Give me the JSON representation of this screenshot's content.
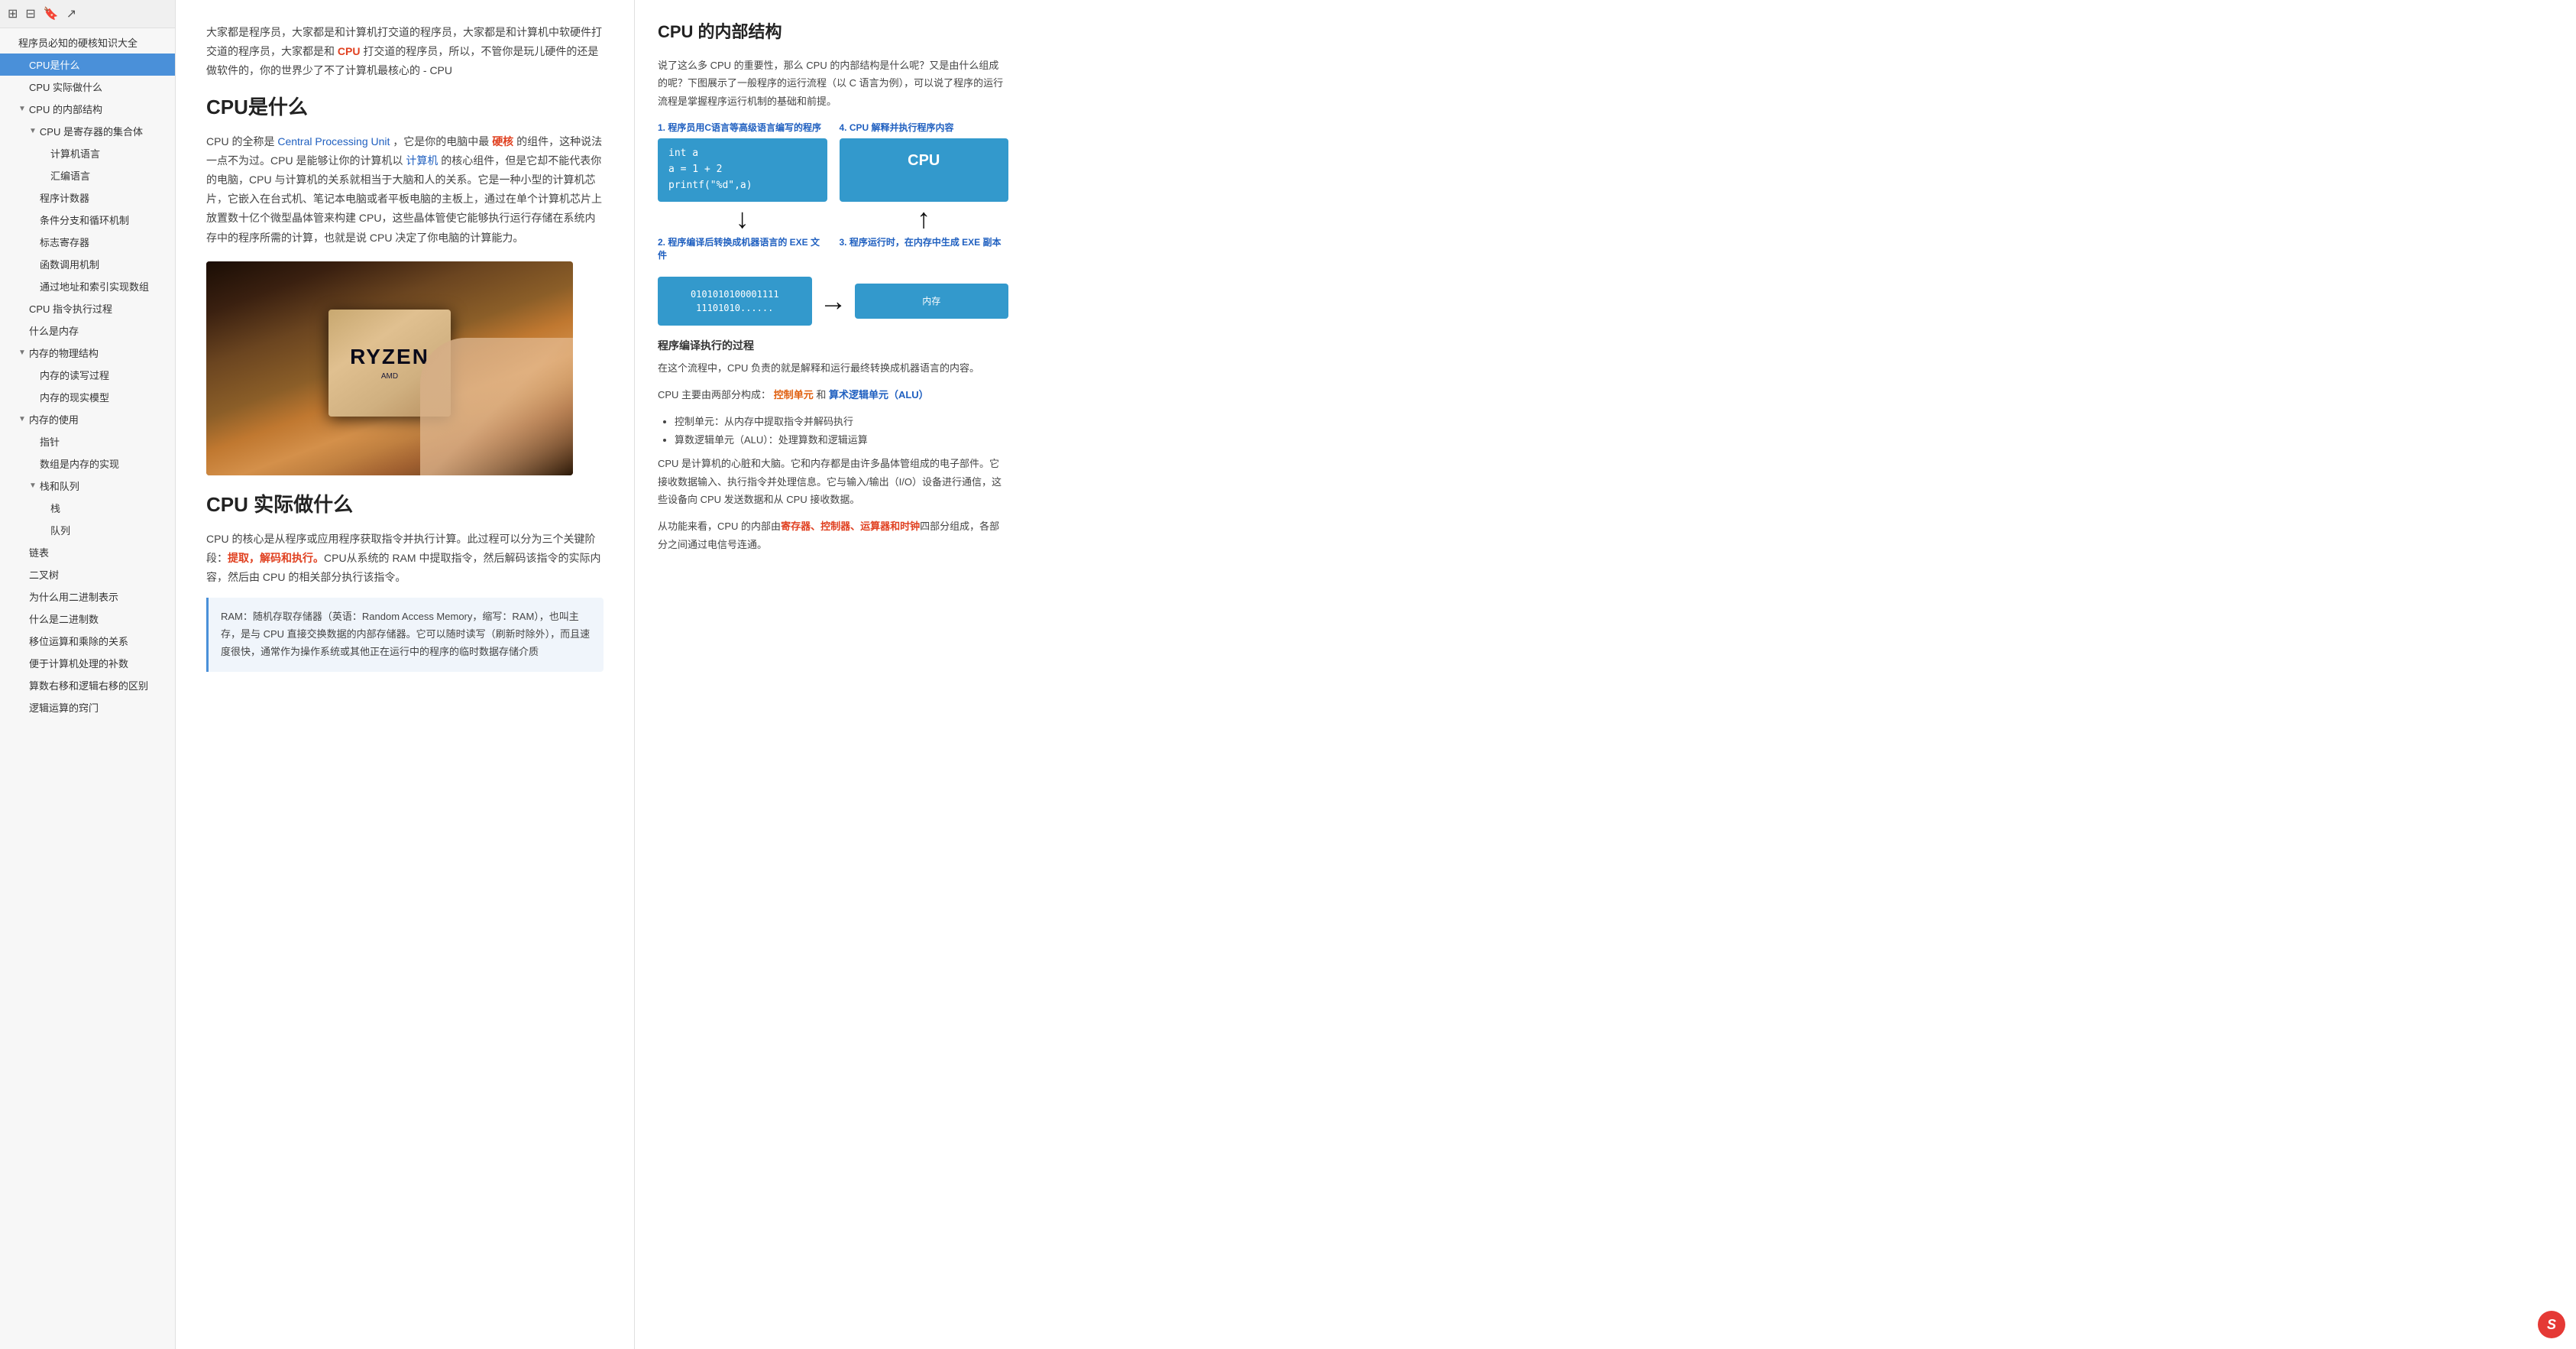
{
  "sidebar": {
    "toolbar_icons": [
      "grid-icon",
      "grid2-icon",
      "bookmark-icon",
      "share-icon"
    ],
    "items": [
      {
        "label": "程序员必知的硬核知识大全",
        "level": 0,
        "toggle": null,
        "active": false
      },
      {
        "label": "CPU是什么",
        "level": 1,
        "toggle": null,
        "active": true
      },
      {
        "label": "CPU 实际做什么",
        "level": 1,
        "toggle": null,
        "active": false
      },
      {
        "label": "CPU 的内部结构",
        "level": 1,
        "toggle": "▼",
        "active": false
      },
      {
        "label": "CPU 是寄存器的集合体",
        "level": 2,
        "toggle": "▼",
        "active": false
      },
      {
        "label": "计算机语言",
        "level": 3,
        "toggle": null,
        "active": false
      },
      {
        "label": "汇编语言",
        "level": 3,
        "toggle": null,
        "active": false
      },
      {
        "label": "程序计数器",
        "level": 2,
        "toggle": null,
        "active": false
      },
      {
        "label": "条件分支和循环机制",
        "level": 2,
        "toggle": null,
        "active": false
      },
      {
        "label": "标志寄存器",
        "level": 2,
        "toggle": null,
        "active": false
      },
      {
        "label": "函数调用机制",
        "level": 2,
        "toggle": null,
        "active": false
      },
      {
        "label": "通过地址和索引实现数组",
        "level": 2,
        "toggle": null,
        "active": false
      },
      {
        "label": "CPU 指令执行过程",
        "level": 1,
        "toggle": null,
        "active": false
      },
      {
        "label": "什么是内存",
        "level": 1,
        "toggle": null,
        "active": false
      },
      {
        "label": "内存的物理结构",
        "level": 1,
        "toggle": "▼",
        "active": false
      },
      {
        "label": "内存的读写过程",
        "level": 2,
        "toggle": null,
        "active": false
      },
      {
        "label": "内存的现实模型",
        "level": 2,
        "toggle": null,
        "active": false
      },
      {
        "label": "内存的使用",
        "level": 1,
        "toggle": "▼",
        "active": false
      },
      {
        "label": "指针",
        "level": 2,
        "toggle": null,
        "active": false
      },
      {
        "label": "数组是内存的实现",
        "level": 2,
        "toggle": null,
        "active": false
      },
      {
        "label": "栈和队列",
        "level": 2,
        "toggle": "▼",
        "active": false
      },
      {
        "label": "栈",
        "level": 3,
        "toggle": null,
        "active": false
      },
      {
        "label": "队列",
        "level": 3,
        "toggle": null,
        "active": false
      },
      {
        "label": "链表",
        "level": 1,
        "toggle": null,
        "active": false
      },
      {
        "label": "二叉树",
        "level": 1,
        "toggle": null,
        "active": false
      },
      {
        "label": "为什么用二进制表示",
        "level": 1,
        "toggle": null,
        "active": false
      },
      {
        "label": "什么是二进制数",
        "level": 1,
        "toggle": null,
        "active": false
      },
      {
        "label": "移位运算和乘除的关系",
        "level": 1,
        "toggle": null,
        "active": false
      },
      {
        "label": "便于计算机处理的补数",
        "level": 1,
        "toggle": null,
        "active": false
      },
      {
        "label": "算数右移和逻辑右移的区别",
        "level": 1,
        "toggle": null,
        "active": false
      },
      {
        "label": "逻辑运算的窍门",
        "level": 1,
        "toggle": null,
        "active": false
      }
    ]
  },
  "main": {
    "intro_text": "大家都是程序员，大家都是和计算机打交道的程序员，大家都是和计算机中软硬件打交道的程序员，大家都是和 CPU 打交道的程序员，所以，不管你是玩儿硬件的还是做软件的，你的世界少了不了计算机最核心的 - CPU",
    "section1_title": "CPU是什么",
    "section1_p1_pre": "CPU 的全称是 ",
    "section1_p1_link": "Central Processing Unit",
    "section1_p1_mid": " ，它是你的电脑中最 ",
    "section1_p1_bold": "硬核",
    "section1_p1_post": " 的组件，这种说法一点不为过。CPU 是能够让你的计算机以 ",
    "section1_p1_link2": "计算机",
    "section1_p1_end": " 的核心组件，但是它却不能代表你的电脑，CPU 与计算机的关系就相当于大脑和人的关系。它是一种小型的计算机芯片，它嵌入在台式机、笔记本电脑或者平板电脑的主板上，通过在单个计算机芯片上放置数十亿个微型晶体管来构建 CPU，这些晶体管使它能够执行运行存储在系统内存中的程序所需的计算，也就是说 CPU 决定了你电脑的计算能力。",
    "section2_title": "CPU 实际做什么",
    "section2_p1_pre": "CPU 的核心是从程序或应用程序获取指令并执行计算。此过程可以分为三个关键阶段：",
    "section2_p1_bold": "提取，解码和执行。",
    "section2_p1_end": "CPU从系统的 RAM 中提取指令，然后解码该指令的实际内容，然后由 CPU 的相关部分执行该指令。",
    "blockquote_text": "RAM：随机存取存储器（英语：Random Access Memory，缩写：RAM），也叫主存，是与 CPU 直接交换数据的内部存储器。它可以随时读写（刷新时除外），而且速度很快，通常作为操作系统或其他正在运行中的程序的临时数据存储介质"
  },
  "right_panel": {
    "title": "CPU 的内部结构",
    "intro_p1": "说了这么多 CPU 的重要性，那么 CPU 的内部结构是什么呢？又是由什么组成的呢？下图展示了一般程序的运行流程（以 C 语言为例），可以说了程序的运行流程是掌握程序运行机制的基础和前提。",
    "step1_label": "1. 程序员用C语言等高级语言编写的程序",
    "step4_label": "4. CPU 解释并执行程序内容",
    "code_line1": "int a",
    "code_line2": "a = 1 + 2",
    "code_line3": "printf(\"%d\",a)",
    "cpu_label": "CPU",
    "step2_label": "2. 程序编译后转换成机器语言的 EXE 文件",
    "step3_label": "3. 程序运行时，在内存中生成 EXE 副本",
    "binary_text": "0101010100001111\n11101010......",
    "memory_label": "内存",
    "program_exec_title": "程序编译执行的过程",
    "program_exec_p1": "在这个流程中，CPU 负责的就是解释和运行最终转换成机器语言的内容。",
    "cpu_components_p": "CPU 主要由两部分构成：",
    "control_unit": "控制单元",
    "and_text": " 和 ",
    "alu_unit": "算术逻辑单元（ALU）",
    "bullet1": "控制单元：从内存中提取指令并解码执行",
    "bullet2": "算数逻辑单元（ALU）：处理算数和逻辑运算",
    "cpu_desc_p": "CPU 是计算机的心脏和大脑。它和内存都是由许多晶体管组成的电子部件。它接收数据输入、执行指令并处理信息。它与输入/输出（I/O）设备进行通信，这些设备向 CPU 发送数据和从 CPU 接收数据。",
    "cpu_function_p": "从功能来看，CPU 的内部由寄存器、控制器、运算器和时钟四部分组成，各部分之间通过电信号连通。",
    "registers_bold": "寄存器、控制器、运算器和时钟"
  },
  "logo": "S"
}
